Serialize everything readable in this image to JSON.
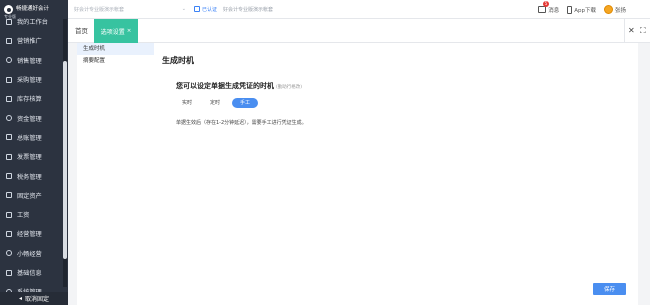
{
  "app": {
    "logo_name": "畅捷通好会计",
    "logo_sub": "专业版"
  },
  "sidebar": {
    "items": [
      {
        "label": "我的工作台",
        "icon": "workbench-icon"
      },
      {
        "label": "营销推广",
        "icon": "promotion-icon"
      },
      {
        "label": "销售管理",
        "icon": "sales-icon"
      },
      {
        "label": "采购管理",
        "icon": "purchase-icon"
      },
      {
        "label": "库存核算",
        "icon": "inventory-icon"
      },
      {
        "label": "资金管理",
        "icon": "funds-icon"
      },
      {
        "label": "总账管理",
        "icon": "ledger-icon"
      },
      {
        "label": "发票管理",
        "icon": "invoice-icon"
      },
      {
        "label": "税务管理",
        "icon": "tax-icon"
      },
      {
        "label": "固定资产",
        "icon": "assets-icon"
      },
      {
        "label": "工资",
        "icon": "salary-icon"
      },
      {
        "label": "经营管理",
        "icon": "operation-icon"
      },
      {
        "label": "小畅经营",
        "icon": "assistant-icon"
      },
      {
        "label": "基础信息",
        "icon": "basic-info-icon"
      },
      {
        "label": "系统管理",
        "icon": "system-icon"
      }
    ],
    "footer_label": "取消固定"
  },
  "topbar": {
    "company_placeholder": "好会计专业版演示帐套",
    "cert_label": "已认证",
    "cert_name": "好会计专业版演示帐套",
    "message_label": "消息",
    "message_count": "5",
    "app_download_label": "App下载",
    "user_name": "张扬"
  },
  "tabs": {
    "home": "首页",
    "active": "选项设置",
    "close_symbol": "×",
    "close_all_symbol": "✕",
    "fullscreen_symbol": "⛶"
  },
  "inner_nav": {
    "items": [
      "生成时机",
      "摘要配置"
    ],
    "active_index": 0
  },
  "content": {
    "title": "生成时机",
    "question": "您可以设定单据生成凭证的时机",
    "question_note": "(勤助行格改)",
    "options": [
      "实时",
      "定时",
      "手工"
    ],
    "selected_option": "手工",
    "description": "单据生效后（存在1-2分钟延迟），需要手工进行凭证生成。",
    "save_label": "保存"
  },
  "colors": {
    "sidebar_bg": "#2c3340",
    "accent_tab": "#37c3a0",
    "primary": "#4a8ef0"
  }
}
